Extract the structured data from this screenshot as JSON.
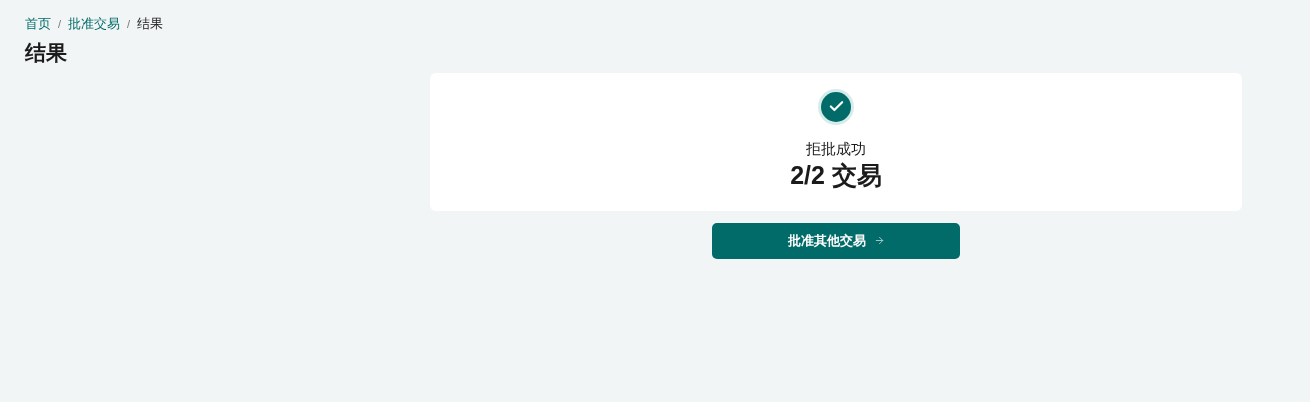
{
  "breadcrumb": [
    {
      "label": "首页",
      "current": false
    },
    {
      "label": "批准交易",
      "current": false
    },
    {
      "label": "结果",
      "current": true
    }
  ],
  "breadcrumb_separator": "/",
  "page_title": "结果",
  "result": {
    "kind": "success",
    "message": "拒批成功",
    "count": "2/2 交易"
  },
  "action_button": {
    "label": "批准其他交易"
  }
}
